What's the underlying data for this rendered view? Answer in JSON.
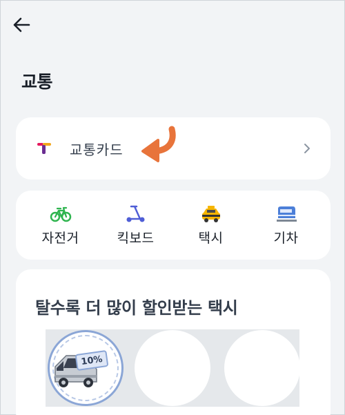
{
  "header": {
    "back_icon": "arrow-left-icon",
    "title": "교통"
  },
  "transit_card": {
    "logo_icon": "tmoney-logo-icon",
    "label": "교통카드",
    "pointer_icon": "curved-arrow-icon",
    "pointer_color": "#e8743b",
    "chevron_icon": "chevron-right-icon"
  },
  "modes": [
    {
      "label": "자전거",
      "icon": "bicycle-icon"
    },
    {
      "label": "킥보드",
      "icon": "kickboard-icon"
    },
    {
      "label": "택시",
      "icon": "taxi-icon"
    },
    {
      "label": "기차",
      "icon": "train-icon"
    }
  ],
  "taxi_promo": {
    "title": "탈수록 더 많이 할인받는 택시",
    "items": [
      {
        "badge": "10%",
        "icon": "taxi-van-icon"
      },
      {
        "badge": "",
        "icon": ""
      },
      {
        "badge": "",
        "icon": ""
      }
    ]
  },
  "colors": {
    "background": "#f2f4f6",
    "card": "#ffffff",
    "text": "#191f28"
  }
}
